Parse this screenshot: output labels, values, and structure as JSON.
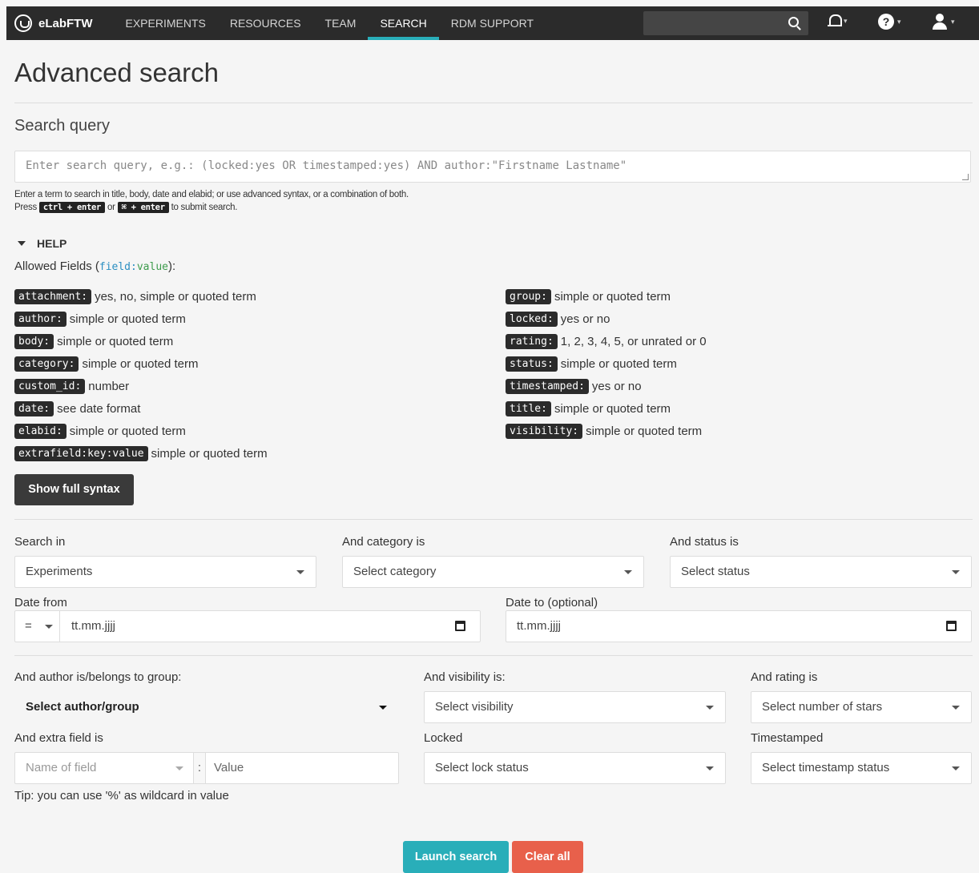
{
  "nav": {
    "brand": "eLabFTW",
    "items": [
      "EXPERIMENTS",
      "RESOURCES",
      "TEAM",
      "SEARCH",
      "RDM SUPPORT"
    ],
    "active": "SEARCH"
  },
  "page": {
    "title": "Advanced search",
    "query_section_title": "Search query"
  },
  "query": {
    "placeholder": "Enter search query, e.g.: (locked:yes OR timestamped:yes) AND author:\"Firstname Lastname\"",
    "hint_line1": "Enter a term to search in title, body, date and elabid; or use advanced syntax, or a combination of both.",
    "hint_press": "Press",
    "hint_key1": "ctrl + enter",
    "hint_or": "or",
    "hint_key2": "⌘ + enter",
    "hint_submit": "to submit search."
  },
  "help": {
    "toggle_label": "HELP",
    "allowed_prefix": "Allowed Fields (",
    "allowed_field": "field",
    "allowed_colon": ":",
    "allowed_value": "value",
    "allowed_suffix": "):",
    "fields_left": [
      {
        "tag": "attachment:",
        "desc": "yes, no, simple or quoted term"
      },
      {
        "tag": "author:",
        "desc": "simple or quoted term"
      },
      {
        "tag": "body:",
        "desc": "simple or quoted term"
      },
      {
        "tag": "category:",
        "desc": "simple or quoted term"
      },
      {
        "tag": "custom_id:",
        "desc": "number"
      },
      {
        "tag": "date:",
        "desc": "see date format"
      },
      {
        "tag": "elabid:",
        "desc": "simple or quoted term"
      },
      {
        "tag": "extrafield:key:value",
        "desc": "simple or quoted term"
      }
    ],
    "fields_right": [
      {
        "tag": "group:",
        "desc": "simple or quoted term"
      },
      {
        "tag": "locked:",
        "desc": "yes or no"
      },
      {
        "tag": "rating:",
        "desc": "1, 2, 3, 4, 5, or unrated or 0"
      },
      {
        "tag": "status:",
        "desc": "simple or quoted term"
      },
      {
        "tag": "timestamped:",
        "desc": "yes or no"
      },
      {
        "tag": "title:",
        "desc": "simple or quoted term"
      },
      {
        "tag": "visibility:",
        "desc": "simple or quoted term"
      }
    ],
    "show_syntax_label": "Show full syntax"
  },
  "filters": {
    "search_in": {
      "label": "Search in",
      "value": "Experiments"
    },
    "category": {
      "label": "And category is",
      "value": "Select category"
    },
    "status": {
      "label": "And status is",
      "value": "Select status"
    },
    "date_from": {
      "label": "Date from",
      "operator": "=",
      "placeholder": "tt.mm.jjjj"
    },
    "date_to": {
      "label": "Date to (optional)",
      "placeholder": "tt.mm.jjjj"
    },
    "author": {
      "label": "And author is/belongs to group:",
      "value": "Select author/group"
    },
    "visibility": {
      "label": "And visibility is:",
      "value": "Select visibility"
    },
    "rating": {
      "label": "And rating is",
      "value": "Select number of stars"
    },
    "extra_field": {
      "label": "And extra field is",
      "name_placeholder": "Name of field",
      "separator": ":",
      "value_placeholder": "Value"
    },
    "locked": {
      "label": "Locked",
      "value": "Select lock status"
    },
    "timestamped": {
      "label": "Timestamped",
      "value": "Select timestamp status"
    },
    "tip": "Tip: you can use '%' as wildcard in value"
  },
  "actions": {
    "launch": "Launch search",
    "clear": "Clear all"
  },
  "colors": {
    "navbar": "#2b2b2b",
    "accent": "#29aeb9",
    "danger": "#e8604b"
  }
}
